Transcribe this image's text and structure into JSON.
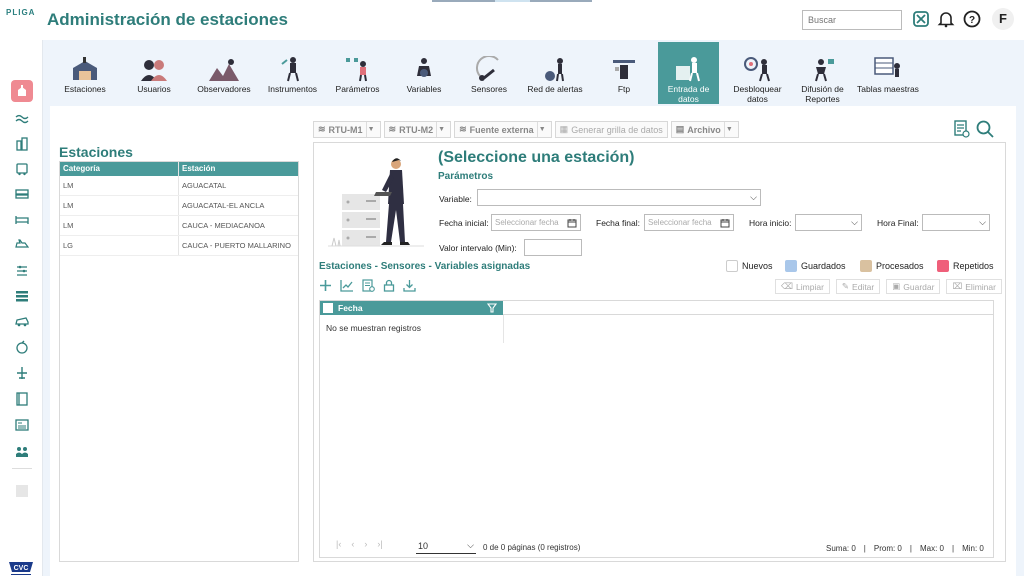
{
  "header": {
    "logo": "PLIGA",
    "title": "Administración de estaciones",
    "search_placeholder": "Buscar",
    "avatar_initial": "F"
  },
  "modules": [
    {
      "label": "Estaciones",
      "icon": "stations-illustration"
    },
    {
      "label": "Usuarios",
      "icon": "users-illustration"
    },
    {
      "label": "Observadores",
      "icon": "observers-illustration"
    },
    {
      "label": "Instrumentos",
      "icon": "instruments-illustration"
    },
    {
      "label": "Parámetros",
      "icon": "parameters-illustration"
    },
    {
      "label": "Variables",
      "icon": "variables-illustration"
    },
    {
      "label": "Sensores",
      "icon": "sensors-illustration"
    },
    {
      "label": "Red de alertas",
      "icon": "alerts-illustration"
    },
    {
      "label": "Ftp",
      "icon": "ftp-illustration"
    },
    {
      "label": "Entrada de datos",
      "icon": "data-entry-illustration",
      "active": true
    },
    {
      "label": "Desbloquear datos",
      "icon": "unlock-illustration"
    },
    {
      "label": "Difusión de Reportes",
      "icon": "reports-illustration"
    },
    {
      "label": "Tablas maestras",
      "icon": "master-tables-illustration"
    }
  ],
  "subtoolbar": {
    "rtu_m1": "RTU-M1",
    "rtu_m2": "RTU-M2",
    "fuente_externa": "Fuente externa",
    "generar_grilla": "Generar grilla de datos",
    "archivo": "Archivo"
  },
  "stations": {
    "title": "Estaciones",
    "columns": [
      "Categoría",
      "Estación"
    ],
    "rows": [
      [
        "LM",
        "AGUACATAL"
      ],
      [
        "LM",
        "AGUACATAL-EL ANCLA"
      ],
      [
        "LM",
        "CAUCA - MEDIACANOA"
      ],
      [
        "LG",
        "CAUCA - PUERTO MALLARINO"
      ]
    ]
  },
  "form": {
    "title": "(Seleccione una estación)",
    "params_title": "Parámetros",
    "variable_label": "Variable:",
    "fecha_inicial_label": "Fecha inicial:",
    "fecha_inicial_placeholder": "Seleccionar fecha",
    "fecha_final_label": "Fecha final:",
    "fecha_final_placeholder": "Seleccionar fecha",
    "hora_inicio_label": "Hora inicio:",
    "hora_final_label": "Hora Final:",
    "valor_intervalo_label": "Valor intervalo (Min):"
  },
  "assigned": {
    "title": "Estaciones - Sensores - Variables asignadas",
    "legend": [
      {
        "label": "Nuevos",
        "color": "#ffffff"
      },
      {
        "label": "Guardados",
        "color": "#a9c7ea"
      },
      {
        "label": "Procesados",
        "color": "#d9c1a0"
      },
      {
        "label": "Repetidos",
        "color": "#ef5f7a"
      }
    ],
    "buttons": {
      "limpiar": "Limpiar",
      "editar": "Editar",
      "guardar": "Guardar",
      "eliminar": "Eliminar"
    },
    "grid_header": "Fecha",
    "no_records": "No se muestran registros"
  },
  "pager": {
    "page_size": "10",
    "info": "0 de 0 páginas (0 registros)",
    "suma": "Suma: 0",
    "prom": "Prom: 0",
    "max": "Max: 0",
    "min": "Min: 0"
  },
  "colors": {
    "accent": "#4a9a9a",
    "title": "#2e7d7a",
    "sidebar_active": "#ef8a92"
  }
}
